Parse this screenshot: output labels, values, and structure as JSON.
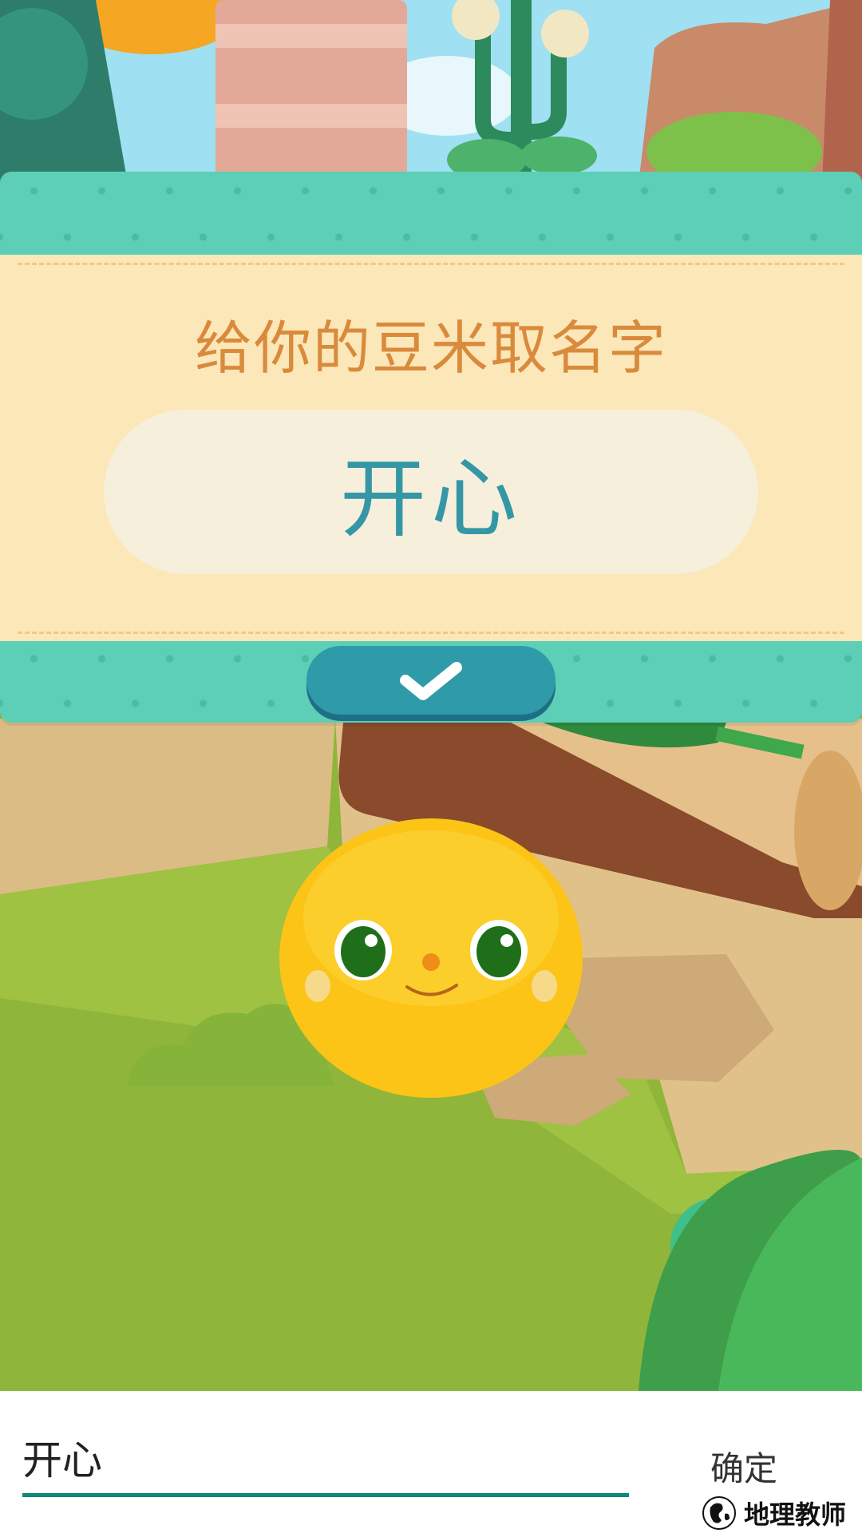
{
  "dialog": {
    "title": "给你的豆米取名字",
    "name_value": "开心",
    "confirm_icon": "checkmark-icon"
  },
  "input_bar": {
    "text_value": "开心",
    "ok_label": "确定"
  },
  "watermark": {
    "text": "地理教师",
    "logo_icon": "globe-logo-icon"
  },
  "colors": {
    "teal_band": "#5ccfb6",
    "paper": "#fbe7b8",
    "title": "#d98a3c",
    "name_text": "#3597a6",
    "button": "#2f9aa8",
    "underline": "#0e8a7a"
  }
}
